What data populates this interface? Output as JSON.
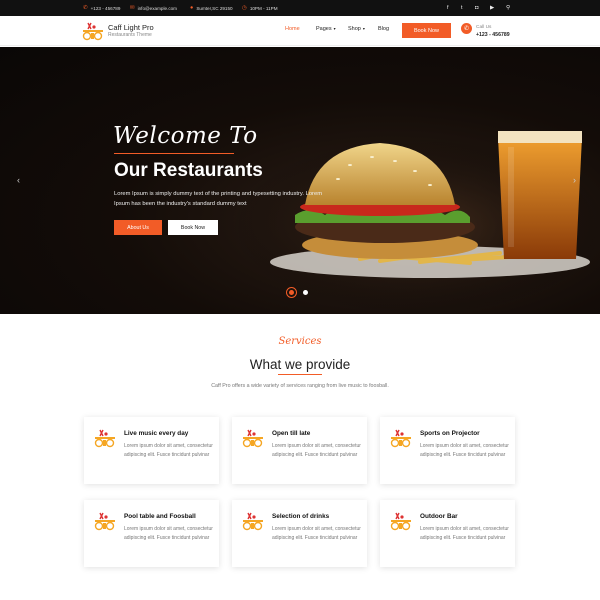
{
  "topbar": {
    "phone": "+123 - 456789",
    "email": "info@example.com",
    "address": "Sumter,SC 29150",
    "hours": "10PM - 11PM",
    "social_icons": [
      "facebook-icon",
      "twitter-icon",
      "instagram-icon",
      "youtube-icon",
      "search-icon"
    ]
  },
  "header": {
    "brand_title": "Caff Light Pro",
    "brand_subtitle": "Restaurants Theme",
    "nav": [
      "Home",
      "Pages",
      "Shop",
      "Blog"
    ],
    "book_button": "Book Now",
    "call_label": "Call Us",
    "call_number": "+123 - 456789"
  },
  "hero": {
    "script": "Welcome To",
    "title": "Our Restaurants",
    "text": "Lorem Ipsum is simply dummy text of the printing and typesetting industry. Lorem Ipsum has been the industry's standard dummy text",
    "about_button": "About Us",
    "book_button": "Book Now",
    "prev_arrow": "‹",
    "next_arrow": "›"
  },
  "services": {
    "script": "Services",
    "heading": "What we provide",
    "description": "Caff Pro offers a wide variety of services ranging from live music to foosball.",
    "cards": [
      {
        "title": "Live music every day",
        "text": "Lorem ipsum dolor sit amet, consectetur adipiscing elit. Fusce tincidunt pulvinar"
      },
      {
        "title": "Open till late",
        "text": "Lorem ipsum dolor sit amet, consectetur adipiscing elit. Fusce tincidunt pulvinar"
      },
      {
        "title": "Sports on Projector",
        "text": "Lorem ipsum dolor sit amet, consectetur adipiscing elit. Fusce tincidunt pulvinar"
      },
      {
        "title": "Pool table and Foosball",
        "text": "Lorem ipsum dolor sit amet, consectetur adipiscing elit. Fusce tincidunt pulvinar"
      },
      {
        "title": "Selection of drinks",
        "text": "Lorem ipsum dolor sit amet, consectetur adipiscing elit. Fusce tincidunt pulvinar"
      },
      {
        "title": "Outdoor Bar",
        "text": "Lorem ipsum dolor sit amet, consectetur adipiscing elit. Fusce tincidunt pulvinar"
      }
    ]
  },
  "colors": {
    "accent": "#f25c27",
    "topbar": "#111111",
    "hero_bg": "#130c08"
  }
}
